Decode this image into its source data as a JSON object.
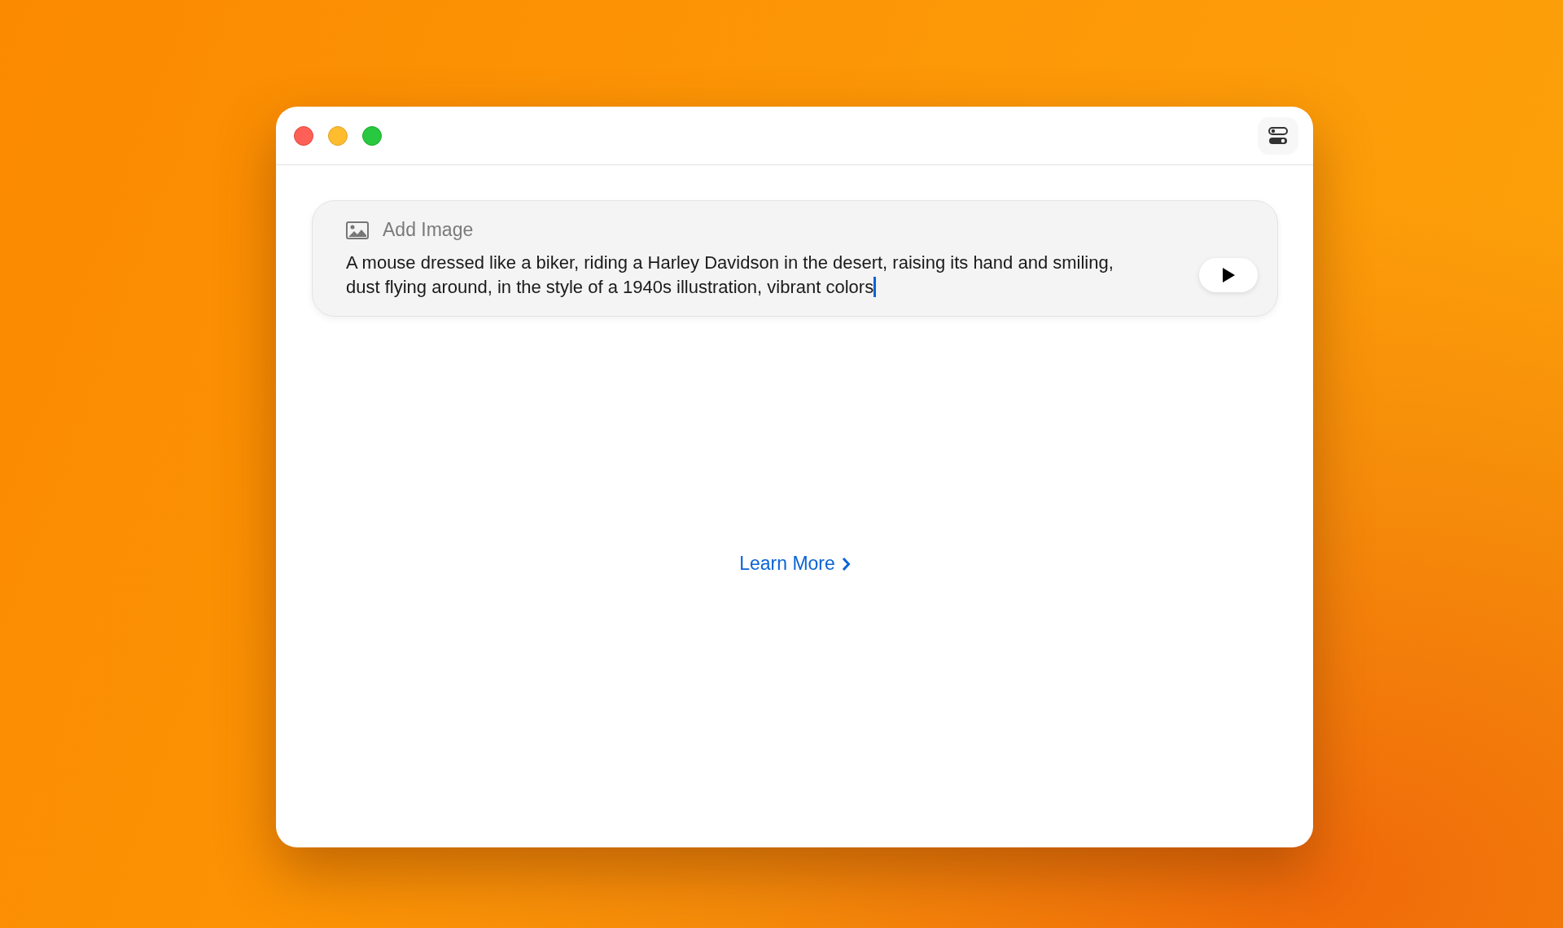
{
  "composer": {
    "add_image_label": "Add Image",
    "prompt": "A mouse dressed like a biker, riding a Harley Davidson in the desert, raising its hand and smiling, dust flying around, in the style of a 1940s illustration, vibrant colors"
  },
  "learn_more": {
    "label": "Learn More"
  }
}
